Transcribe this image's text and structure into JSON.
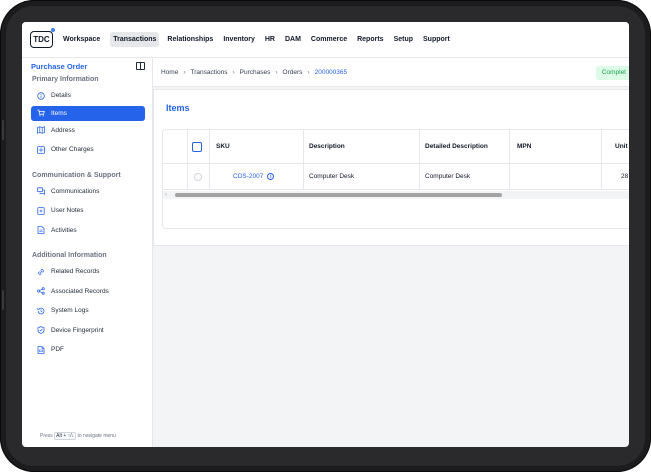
{
  "nav": {
    "logo": "TDC",
    "items": [
      "Workspace",
      "Transactions",
      "Relationships",
      "Inventory",
      "HR",
      "DAM",
      "Commerce",
      "Reports",
      "Setup",
      "Support"
    ],
    "active_index": 1
  },
  "sidebar": {
    "title": "Purchase Order",
    "sections": [
      {
        "title": "Primary Information",
        "items": [
          {
            "label": "Details",
            "icon": "info-icon"
          },
          {
            "label": "Items",
            "icon": "cart-icon",
            "active": true
          },
          {
            "label": "Address",
            "icon": "map-icon"
          },
          {
            "label": "Other Charges",
            "icon": "charges-icon"
          }
        ]
      },
      {
        "title": "Communication & Support",
        "items": [
          {
            "label": "Communications",
            "icon": "chat-icon"
          },
          {
            "label": "User Notes",
            "icon": "note-icon"
          },
          {
            "label": "Activities",
            "icon": "activity-icon"
          }
        ]
      },
      {
        "title": "Additional Information",
        "items": [
          {
            "label": "Related Records",
            "icon": "link-icon"
          },
          {
            "label": "Associated Records",
            "icon": "associated-icon"
          },
          {
            "label": "System Logs",
            "icon": "history-icon"
          },
          {
            "label": "Device Fingerprint",
            "icon": "shield-icon"
          },
          {
            "label": "PDF",
            "icon": "pdf-icon"
          }
        ]
      }
    ],
    "footer": {
      "prefix": "Press",
      "keys": "Alt + ↑/↓",
      "suffix": "to navigate menu"
    }
  },
  "breadcrumb": [
    "Home",
    "Transactions",
    "Purchases",
    "Orders",
    "200000365"
  ],
  "status": "Complet",
  "items_section": {
    "title": "Items",
    "columns": [
      "SKU",
      "Description",
      "Detailed Description",
      "MPN",
      "Unit P"
    ],
    "rows": [
      {
        "sku": "CDS-2007",
        "description": "Computer Desk",
        "detailed_description": "Computer Desk",
        "mpn": "",
        "unit_price": "28"
      }
    ]
  },
  "colors": {
    "accent": "#2563eb",
    "status_bg": "#dcfce7",
    "status_text": "#16a34a"
  }
}
